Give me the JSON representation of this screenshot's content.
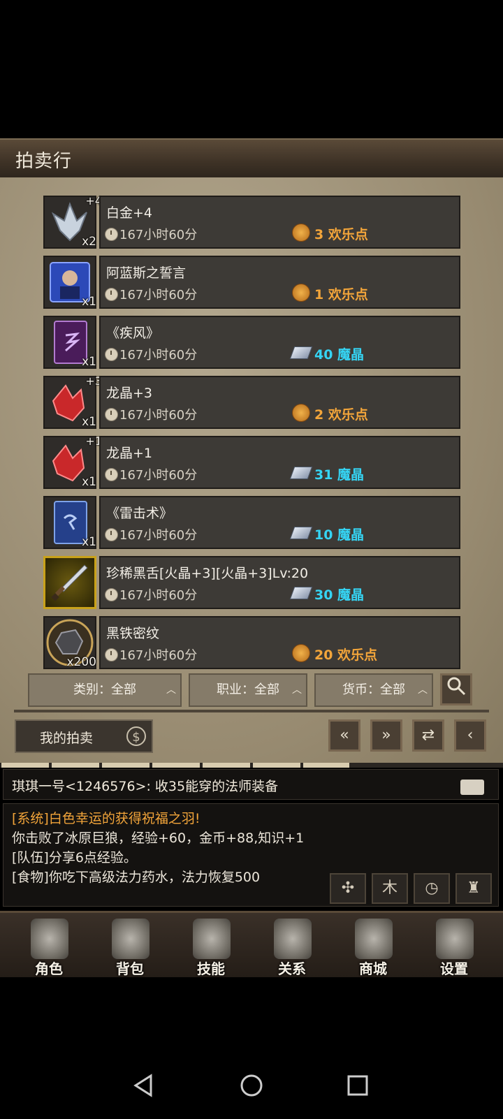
{
  "window": {
    "title": "拍卖行"
  },
  "items": [
    {
      "name": "白金+4",
      "time": "167小时60分",
      "price": "3 欢乐点",
      "currency": "joy",
      "qty": "x2",
      "enhance": "+4",
      "icon": "platinum-crystal-icon"
    },
    {
      "name": "阿蓝斯之誓言",
      "time": "167小时60分",
      "price": "1 欢乐点",
      "currency": "joy",
      "qty": "x1",
      "enhance": "",
      "icon": "portrait-card-icon"
    },
    {
      "name": "《疾风》",
      "time": "167小时60分",
      "price": "40 魔晶",
      "currency": "magic",
      "qty": "x1",
      "enhance": "",
      "icon": "purple-skill-book-icon"
    },
    {
      "name": "龙晶+3",
      "time": "167小时60分",
      "price": "2 欢乐点",
      "currency": "joy",
      "qty": "x1",
      "enhance": "+3",
      "icon": "red-dragon-crystal-icon"
    },
    {
      "name": "龙晶+1",
      "time": "167小时60分",
      "price": "31 魔晶",
      "currency": "magic",
      "qty": "x1",
      "enhance": "+1",
      "icon": "red-dragon-crystal-icon"
    },
    {
      "name": "《雷击术》",
      "time": "167小时60分",
      "price": "10 魔晶",
      "currency": "magic",
      "qty": "x1",
      "enhance": "",
      "icon": "blue-skill-book-icon"
    },
    {
      "name": "珍稀黑舌[火晶+3][火晶+3]Lv:20",
      "time": "167小时60分",
      "price": "30 魔晶",
      "currency": "magic",
      "qty": "",
      "enhance": "",
      "icon": "dagger-icon"
    },
    {
      "name": "黑铁密纹",
      "time": "167小时60分",
      "price": "20 欢乐点",
      "currency": "joy",
      "qty": "x200",
      "enhance": "",
      "icon": "black-iron-ore-icon"
    }
  ],
  "filters": {
    "category": "类别：全部",
    "job": "职业：全部",
    "currency": "货币：全部"
  },
  "controls": {
    "my_auction": "我的拍卖"
  },
  "chat": {
    "input_line": "琪琪一号<1246576>:  收35能穿的法师装备",
    "log": [
      "[系统]白色幸运的获得祝福之羽!",
      "你击败了冰原巨狼，经验+60，金币+88,知识+1",
      "[队伍]分享6点经验。",
      "[食物]你吃下高级法力药水，法力恢复500"
    ]
  },
  "nav": [
    "角色",
    "背包",
    "技能",
    "关系",
    "商城",
    "设置"
  ],
  "colors": {
    "joy_price": "#f3a53a",
    "magic_price": "#35d4f3",
    "system_msg": "#f3a53a"
  }
}
